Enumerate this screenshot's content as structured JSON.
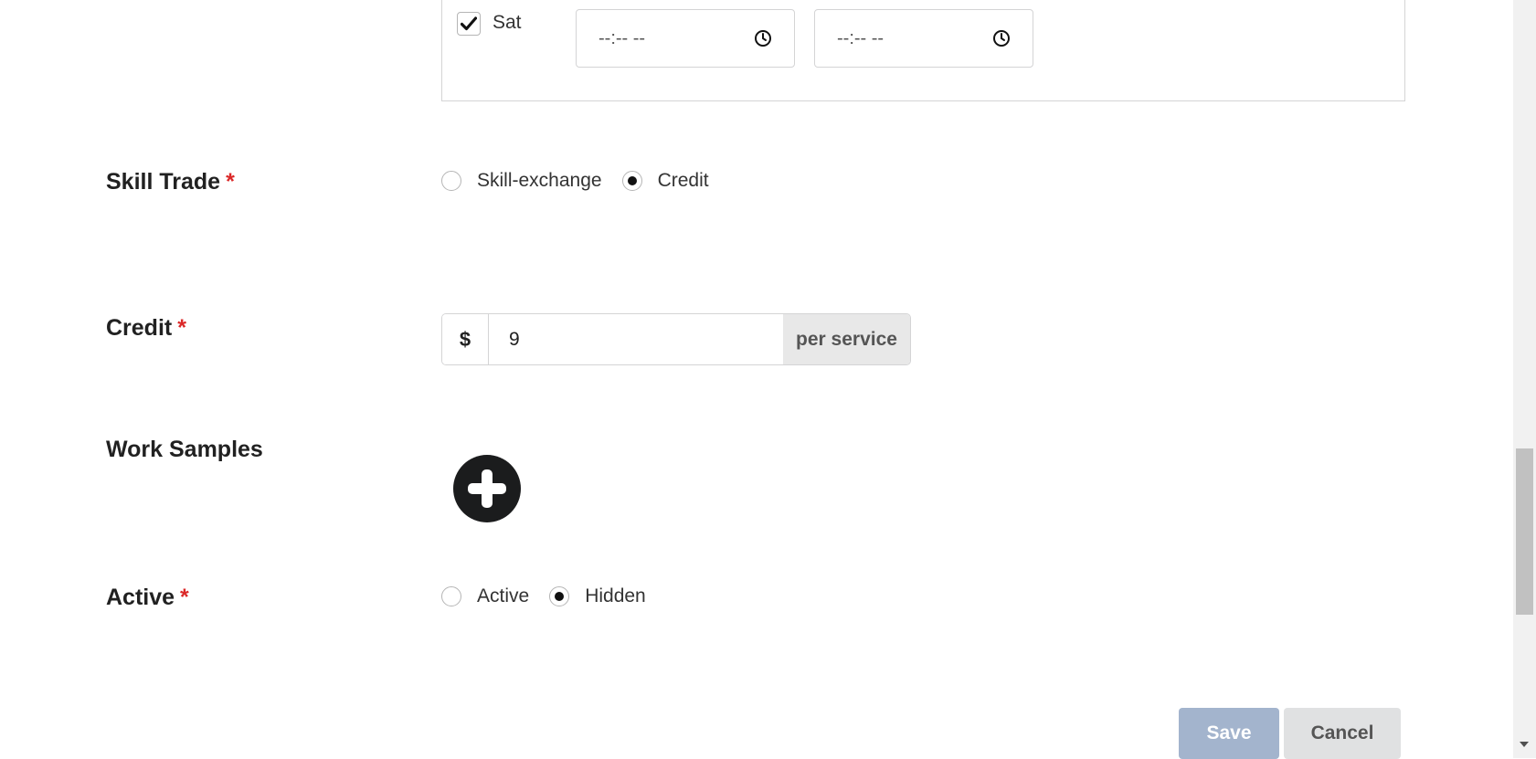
{
  "availability": {
    "day_label": "Sat",
    "day_checked": true,
    "start_time": {
      "value": "--:-- --"
    },
    "end_time": {
      "value": "--:-- --"
    }
  },
  "skill_trade": {
    "label": "Skill Trade",
    "required_mark": "*",
    "options": [
      {
        "label": "Skill-exchange",
        "selected": false
      },
      {
        "label": "Credit",
        "selected": true
      }
    ]
  },
  "credit": {
    "label": "Credit",
    "required_mark": "*",
    "prefix": "$",
    "value": "9",
    "suffix": "per service"
  },
  "work_samples": {
    "label": "Work Samples",
    "add_icon": "plus-circle-icon"
  },
  "active": {
    "label": "Active",
    "required_mark": "*",
    "options": [
      {
        "label": "Active",
        "selected": false
      },
      {
        "label": "Hidden",
        "selected": true
      }
    ]
  },
  "actions": {
    "save_label": "Save",
    "cancel_label": "Cancel"
  },
  "colors": {
    "required": "#db2828",
    "save_button": "#a3b4cd",
    "cancel_button": "#e0e1e2"
  }
}
